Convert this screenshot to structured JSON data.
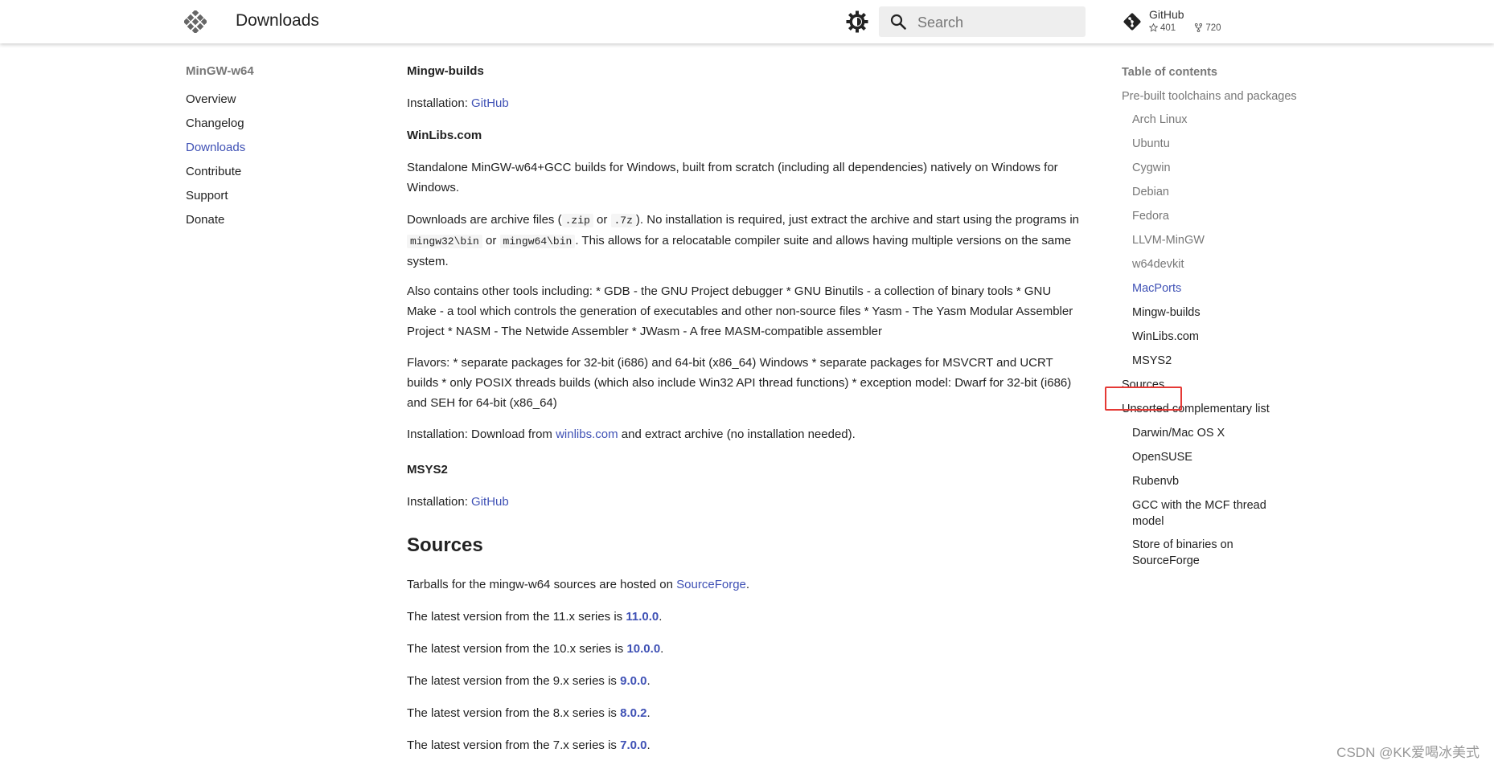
{
  "header": {
    "title": "Downloads",
    "search_placeholder": "Search",
    "repo": {
      "name": "GitHub",
      "stars": "401",
      "forks": "720"
    }
  },
  "left_nav": {
    "title": "MinGW-w64",
    "items": [
      {
        "label": "Overview"
      },
      {
        "label": "Changelog"
      },
      {
        "label": "Downloads"
      },
      {
        "label": "Contribute"
      },
      {
        "label": "Support"
      },
      {
        "label": "Donate"
      }
    ]
  },
  "content": {
    "mingw_builds": {
      "heading": "Mingw-builds",
      "install_prefix": "Installation: ",
      "install_link": "GitHub"
    },
    "winlibs": {
      "heading": "WinLibs.com",
      "p1": "Standalone MinGW-w64+GCC builds for Windows, built from scratch (including all dependencies) natively on Windows for Windows.",
      "p2_a": "Downloads are archive files (",
      "code_zip": ".zip",
      "p2_or": " or ",
      "code_7z": ".7z",
      "p2_b": "). No installation is required, just extract the archive and start using the programs in ",
      "code_bin32": "mingw32\\bin",
      "p2_or2": " or ",
      "code_bin64": "mingw64\\bin",
      "p2_c": ". This allows for a relocatable compiler suite and allows having multiple versions on the same system.",
      "p3": "Also contains other tools including: * GDB - the GNU Project debugger * GNU Binutils - a collection of binary tools * GNU Make - a tool which controls the generation of executables and other non-source files * Yasm - The Yasm Modular Assembler Project * NASM - The Netwide Assembler * JWasm - A free MASM-compatible assembler",
      "p4": "Flavors: * separate packages for 32-bit (i686) and 64-bit (x86_64) Windows * separate packages for MSVCRT and UCRT builds * only POSIX threads builds (which also include Win32 API thread functions) * exception model: Dwarf for 32-bit (i686) and SEH for 64-bit (x86_64)",
      "p5_a": "Installation: Download from ",
      "p5_link": "winlibs.com",
      "p5_b": " and extract archive (no installation needed)."
    },
    "msys2": {
      "heading": "MSYS2",
      "install_prefix": "Installation: ",
      "install_link": "GitHub"
    },
    "sources": {
      "heading": "Sources",
      "intro_a": "Tarballs for the mingw-w64 sources are hosted on ",
      "intro_link": "SourceForge",
      "intro_b": ".",
      "versions": [
        {
          "prefix": "The latest version from the 11.x series is ",
          "version": "11.0.0",
          "suffix": "."
        },
        {
          "prefix": "The latest version from the 10.x series is ",
          "version": "10.0.0",
          "suffix": "."
        },
        {
          "prefix": "The latest version from the 9.x series is ",
          "version": "9.0.0",
          "suffix": "."
        },
        {
          "prefix": "The latest version from the 8.x series is ",
          "version": "8.0.2",
          "suffix": "."
        },
        {
          "prefix": "The latest version from the 7.x series is ",
          "version": "7.0.0",
          "suffix": "."
        }
      ]
    }
  },
  "toc": {
    "title": "Table of contents",
    "items": [
      {
        "label": "Pre-built toolchains and packages"
      },
      {
        "label": "Arch Linux"
      },
      {
        "label": "Ubuntu"
      },
      {
        "label": "Cygwin"
      },
      {
        "label": "Debian"
      },
      {
        "label": "Fedora"
      },
      {
        "label": "LLVM-MinGW"
      },
      {
        "label": "w64devkit"
      },
      {
        "label": "MacPorts"
      },
      {
        "label": "Mingw-builds"
      },
      {
        "label": "WinLibs.com"
      },
      {
        "label": "MSYS2"
      },
      {
        "label": "Sources"
      },
      {
        "label": "Unsorted complementary list"
      },
      {
        "label": "Darwin/Mac OS X"
      },
      {
        "label": "OpenSUSE"
      },
      {
        "label": "Rubenvb"
      },
      {
        "label": "GCC with the MCF thread model"
      },
      {
        "label": "Store of binaries on SourceForge"
      }
    ]
  },
  "watermark": "CSDN @KK爱喝冰美式",
  "colors": {
    "link": "#3f51b5",
    "highlight_box": "#e53935"
  }
}
